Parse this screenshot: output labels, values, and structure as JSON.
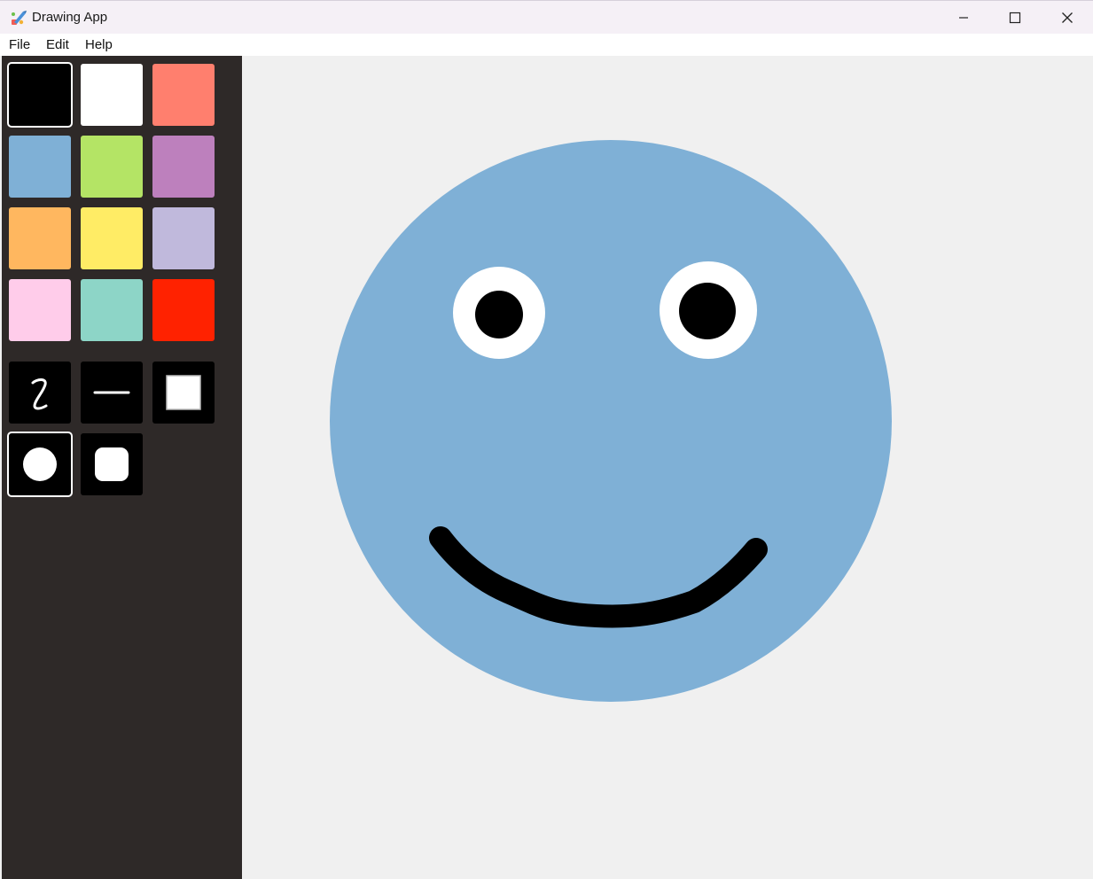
{
  "window": {
    "title": "Drawing App",
    "minimize_icon": "minimize-icon",
    "maximize_icon": "maximize-icon",
    "close_icon": "close-icon"
  },
  "menu": {
    "items": [
      {
        "label": "File"
      },
      {
        "label": "Edit"
      },
      {
        "label": "Help"
      }
    ]
  },
  "palette": {
    "colors": [
      "#000000",
      "#ffffff",
      "#ff7f6e",
      "#7fb0d6",
      "#b4e465",
      "#bd80bd",
      "#ffb75f",
      "#ffec65",
      "#c0b9dc",
      "#ffccea",
      "#8dd5c7",
      "#ff2200"
    ],
    "selected_index": 0
  },
  "tools": {
    "items": [
      {
        "name": "freehand",
        "icon": "freehand-pen-icon"
      },
      {
        "name": "line",
        "icon": "line-icon"
      },
      {
        "name": "rectangle",
        "icon": "rectangle-icon"
      },
      {
        "name": "circle",
        "icon": "circle-icon"
      },
      {
        "name": "rounded-rectangle",
        "icon": "rounded-rectangle-icon"
      }
    ],
    "selected": "circle"
  },
  "drawing": {
    "face_color": "#7fb0d6",
    "eye_white": "#ffffff",
    "pupil_color": "#000000",
    "mouth_color": "#000000"
  }
}
